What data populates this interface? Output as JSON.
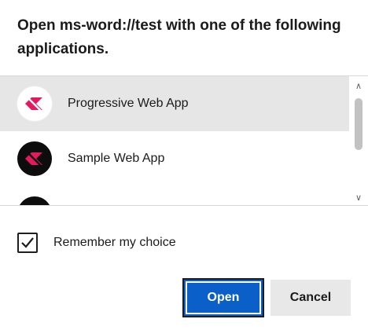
{
  "dialog": {
    "title": "Open ms-word://test with one of the following applications."
  },
  "apps": [
    {
      "label": "Progressive Web App",
      "icon": "pwa-logo-icon",
      "selected": true
    },
    {
      "label": "Sample Web App",
      "icon": "pwa-logo-icon",
      "selected": false
    },
    {
      "label": "",
      "icon": "app-icon",
      "selected": false
    }
  ],
  "remember": {
    "label": "Remember my choice",
    "checked": true
  },
  "buttons": {
    "open_label": "Open",
    "cancel_label": "Cancel"
  },
  "colors": {
    "accent": "#0a5fc8",
    "logo_pink": "#e5195e",
    "selected_row": "#e6e6e6"
  }
}
